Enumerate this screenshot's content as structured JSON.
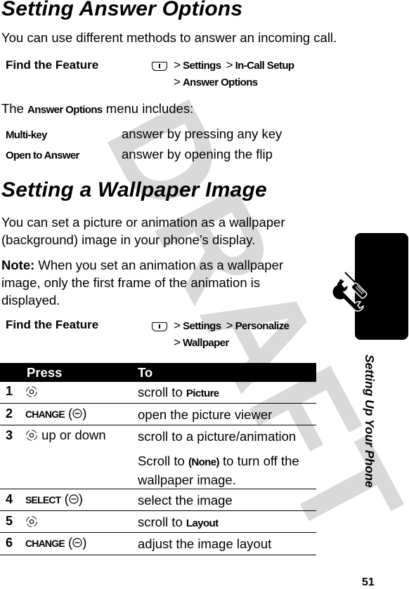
{
  "watermark": "DRAFT",
  "section1": {
    "title": "Setting Answer Options",
    "intro": "You can use different methods to answer an incoming call.",
    "find_feature": {
      "label": "Find the Feature",
      "icon": "menu-key-icon",
      "path_line1": [
        "Settings",
        "In-Call Setup"
      ],
      "path_line2": [
        "Answer Options"
      ]
    },
    "menu_intro_prefix": "The",
    "menu_intro_name": "Answer Options",
    "menu_intro_suffix": "menu includes:",
    "options": [
      {
        "term": "Multi-key",
        "desc": "answer by pressing any key"
      },
      {
        "term": "Open to Answer",
        "desc": "answer by opening the flip"
      }
    ]
  },
  "section2": {
    "title": "Setting a Wallpaper Image",
    "intro": "You can set a picture or animation as a wallpaper (background) image in your phone’s display.",
    "note_label": "Note:",
    "note_text": "When you set an animation as a wallpaper image, only the first frame of the animation is displayed.",
    "find_feature": {
      "label": "Find the Feature",
      "icon": "menu-key-icon",
      "path_line1": [
        "Settings",
        "Personalize"
      ],
      "path_line2": [
        "Wallpaper"
      ]
    },
    "table": {
      "headers": {
        "press": "Press",
        "to": "To"
      },
      "rows": [
        {
          "num": "1",
          "press_icon": "nav-key-icon",
          "press_text": "",
          "to_prefix": "scroll to",
          "to_bold": "Picture",
          "to_note": ""
        },
        {
          "num": "2",
          "softkey": "CHANGE",
          "press_icon": "soft-key-minus-icon",
          "to_text": "open the picture viewer"
        },
        {
          "num": "3",
          "press_icon": "nav-key-icon",
          "press_text": "up or down",
          "to_text": "scroll to a picture/animation",
          "to_note_prefix": "Scroll to",
          "to_note_bold": "(None)",
          "to_note_suffix": "to turn off the wallpaper image."
        },
        {
          "num": "4",
          "softkey": "SELECT",
          "press_icon": "soft-key-minus-icon",
          "to_text": "select the image"
        },
        {
          "num": "5",
          "press_icon": "nav-key-icon",
          "press_text": "",
          "to_prefix": "scroll to",
          "to_bold": "Layout"
        },
        {
          "num": "6",
          "softkey": "CHANGE",
          "press_icon": "soft-key-minus-icon",
          "to_text": "adjust the image layout"
        }
      ]
    }
  },
  "sidebar": {
    "icon": "tools-icon",
    "chapter_label": "Setting Up Your Phone"
  },
  "page_number": "51"
}
